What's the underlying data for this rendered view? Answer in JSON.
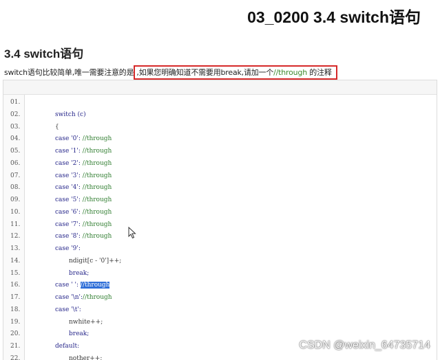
{
  "header": {
    "title": "03_0200 3.4 switch语句"
  },
  "section": {
    "title": "3.4 switch语句",
    "intro_before": "switch语句比较简单,唯一需要注意的是",
    "intro_highlight_text": ",如果您明确知道不需要用break,请加一个",
    "intro_highlight_comment": "//through",
    "intro_highlight_after": " 的注释"
  },
  "code": {
    "lines": [
      {
        "no": "01.",
        "indent": 0,
        "parts": [
          {
            "t": "",
            "c": "plain"
          }
        ]
      },
      {
        "no": "02.",
        "indent": 1,
        "parts": [
          {
            "t": "switch (c)",
            "c": "kw"
          }
        ]
      },
      {
        "no": "03.",
        "indent": 1,
        "parts": [
          {
            "t": "{",
            "c": "plain"
          }
        ]
      },
      {
        "no": "04.",
        "indent": 1,
        "parts": [
          {
            "t": "case '0': ",
            "c": "kw"
          },
          {
            "t": "//through",
            "c": "cm"
          }
        ]
      },
      {
        "no": "05.",
        "indent": 1,
        "parts": [
          {
            "t": "case '1': ",
            "c": "kw"
          },
          {
            "t": "//through",
            "c": "cm"
          }
        ]
      },
      {
        "no": "06.",
        "indent": 1,
        "parts": [
          {
            "t": "case '2': ",
            "c": "kw"
          },
          {
            "t": "//through",
            "c": "cm"
          }
        ]
      },
      {
        "no": "07.",
        "indent": 1,
        "parts": [
          {
            "t": "case '3': ",
            "c": "kw"
          },
          {
            "t": "//through",
            "c": "cm"
          }
        ]
      },
      {
        "no": "08.",
        "indent": 1,
        "parts": [
          {
            "t": "case '4': ",
            "c": "kw"
          },
          {
            "t": "//through",
            "c": "cm"
          }
        ]
      },
      {
        "no": "09.",
        "indent": 1,
        "parts": [
          {
            "t": "case '5': ",
            "c": "kw"
          },
          {
            "t": "//through",
            "c": "cm"
          }
        ]
      },
      {
        "no": "10.",
        "indent": 1,
        "parts": [
          {
            "t": "case '6': ",
            "c": "kw"
          },
          {
            "t": "//through",
            "c": "cm"
          }
        ]
      },
      {
        "no": "11.",
        "indent": 1,
        "parts": [
          {
            "t": "case '7': ",
            "c": "kw"
          },
          {
            "t": "//through",
            "c": "cm"
          }
        ]
      },
      {
        "no": "12.",
        "indent": 1,
        "parts": [
          {
            "t": "case '8': ",
            "c": "kw"
          },
          {
            "t": "//through",
            "c": "cm"
          }
        ]
      },
      {
        "no": "13.",
        "indent": 1,
        "parts": [
          {
            "t": "case '9':",
            "c": "kw"
          }
        ]
      },
      {
        "no": "14.",
        "indent": 2,
        "parts": [
          {
            "t": "ndigit[c - '0']++;",
            "c": "plain"
          }
        ]
      },
      {
        "no": "15.",
        "indent": 2,
        "parts": [
          {
            "t": "break;",
            "c": "kw"
          }
        ]
      },
      {
        "no": "16.",
        "indent": 1,
        "parts": [
          {
            "t": "case ' ': ",
            "c": "kw"
          },
          {
            "t": "//through",
            "c": "sel"
          }
        ]
      },
      {
        "no": "17.",
        "indent": 1,
        "parts": [
          {
            "t": "case '\\n':",
            "c": "kw"
          },
          {
            "t": "//through",
            "c": "cm"
          }
        ]
      },
      {
        "no": "18.",
        "indent": 1,
        "parts": [
          {
            "t": "case '\\t':",
            "c": "kw"
          }
        ]
      },
      {
        "no": "19.",
        "indent": 2,
        "parts": [
          {
            "t": "nwhite++;",
            "c": "plain"
          }
        ]
      },
      {
        "no": "20.",
        "indent": 2,
        "parts": [
          {
            "t": "break;",
            "c": "kw"
          }
        ]
      },
      {
        "no": "21.",
        "indent": 1,
        "parts": [
          {
            "t": "default:",
            "c": "kw"
          }
        ]
      },
      {
        "no": "22.",
        "indent": 2,
        "parts": [
          {
            "t": "nother++;",
            "c": "plain"
          }
        ]
      }
    ]
  },
  "watermark": {
    "text": "CSDN @weixin_64735714"
  }
}
